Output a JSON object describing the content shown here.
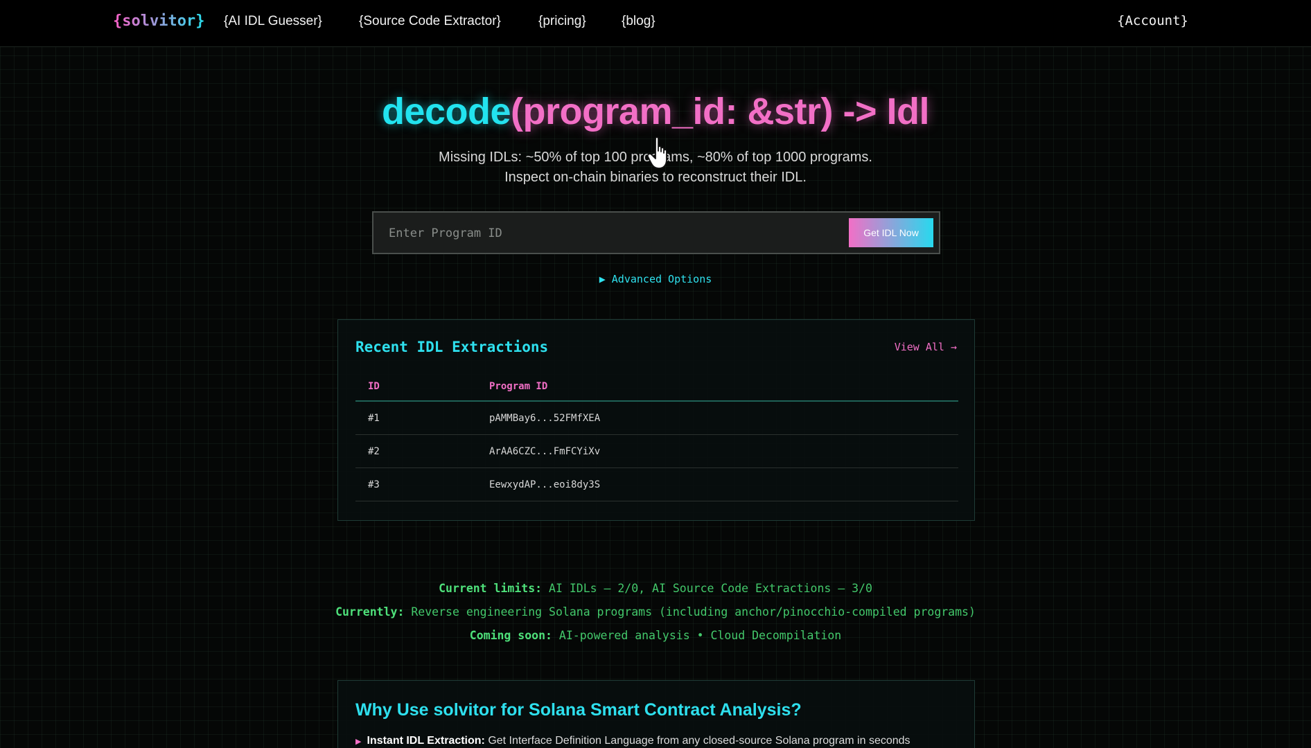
{
  "nav": {
    "brand": "{solvitor}",
    "links": [
      "{AI IDL Guesser}",
      "{Source Code Extractor}",
      "{pricing}",
      "{blog}"
    ],
    "account": "{Account}"
  },
  "hero": {
    "title_fn": "decode",
    "title_sig": "(program_id: &str) -> Idl",
    "subtitle_line1": "Missing IDLs: ~50% of top 100 programs, ~80% of top 1000 programs.",
    "subtitle_line2": "Inspect on-chain binaries to reconstruct their IDL."
  },
  "search": {
    "placeholder": "Enter Program ID",
    "value": "",
    "button_label": "Get IDL Now"
  },
  "advanced": {
    "label": "▶ Advanced Options"
  },
  "recent": {
    "title": "Recent IDL Extractions",
    "view_all": "View All →",
    "columns": [
      "ID",
      "Program ID"
    ],
    "rows": [
      {
        "id": "#1",
        "program_id": "pAMMBay6...52FMfXEA"
      },
      {
        "id": "#2",
        "program_id": "ArAA6CZC...FmFCYiXv"
      },
      {
        "id": "#3",
        "program_id": "EewxydAP...eoi8dy3S"
      }
    ]
  },
  "limits": {
    "current_label": "Current limits:",
    "current_value": "AI IDLs – 2/0, AI Source Code Extractions – 3/0",
    "currently_label": "Currently:",
    "currently_value": "Reverse engineering Solana programs (including anchor/pinocchio-compiled programs)",
    "soon_label": "Coming soon:",
    "soon_value": "AI-powered analysis • Cloud Decompilation"
  },
  "why": {
    "title": "Why Use solvitor for Solana Smart Contract Analysis?",
    "items": [
      {
        "bold": "Instant IDL Extraction:",
        "text": "Get Interface Definition Language from any closed-source Solana program in seconds"
      }
    ]
  },
  "colors": {
    "cyan": "#22e3ef",
    "pink": "#f26fc6",
    "green": "#43c96b",
    "background": "#050706"
  }
}
